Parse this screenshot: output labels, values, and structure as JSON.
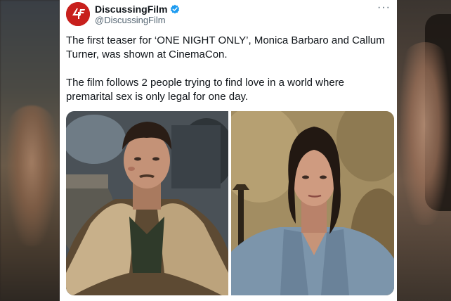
{
  "tweet": {
    "author_name": "DiscussingFilm",
    "author_handle": "@DiscussingFilm",
    "avatar_initials": "4F",
    "verified": true,
    "more_label": "···",
    "paragraph_1": "The first teaser for ‘ONE NIGHT ONLY’, Monica Barbaro and Callum Turner, was shown at CinemaCon.",
    "paragraph_2": "The film follows 2 people trying to find love in a world where premarital sex is only legal for one day."
  },
  "colors": {
    "avatar_red": "#c8201d",
    "verified_blue": "#1d9bf0",
    "text_primary": "#0f1419",
    "text_secondary": "#536471"
  },
  "icons": {
    "verified": "verified-badge-icon",
    "more": "more-options-icon"
  }
}
